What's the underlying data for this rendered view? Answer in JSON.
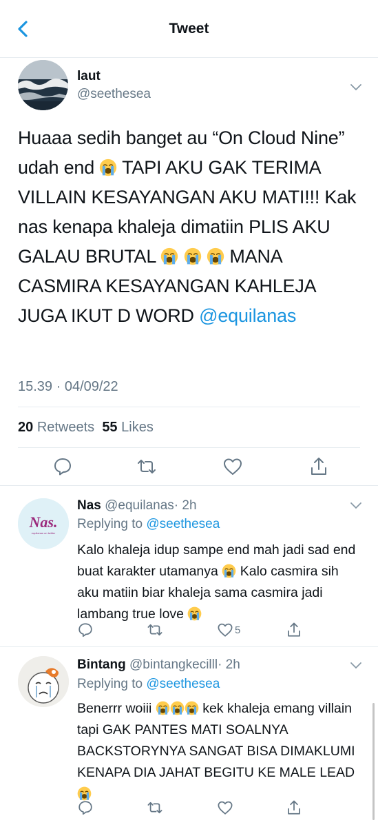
{
  "header": {
    "title": "Tweet",
    "back_icon": "chevron-left-icon",
    "accent_color": "#1b95e0"
  },
  "main_tweet": {
    "name": "laut",
    "handle": "@seethesea",
    "text_parts": {
      "p1": "Huaaa sedih banget au “On Cloud Nine” udah end ",
      "p2": " TAPI AKU GAK TERIMA VILLAIN KESAYANGAN AKU MATI!!! Kak nas kenapa khaleja dimatiin PLIS AKU GALAU BRUTAL ",
      "p3": " MANA CASMIRA KESAYANGAN KAHLEJA JUGA IKUT D WORD ",
      "mention": "@equilanas"
    },
    "timestamp": "15.39 · 04/09/22",
    "retweets_count": "20",
    "retweets_label": "Retweets",
    "likes_count": "55",
    "likes_label": "Likes"
  },
  "replies": [
    {
      "name": "Nas",
      "handle": "@equilanas",
      "time": "· 2h",
      "replying_prefix": "Replying to",
      "replying_to": "@seethesea",
      "text_parts": {
        "p1": "Kalo khaleja idup sampe end mah jadi sad end buat karakter utamanya ",
        "p2": " Kalo casmira sih aku matiin biar khaleja sama casmira jadi lambang true love "
      },
      "avatar_logo": "Nas.",
      "avatar_caption": "equilanas on twitter",
      "like_count": "5"
    },
    {
      "name": "Bintang",
      "handle": "@bintangkecilll",
      "time": "· 2h",
      "replying_prefix": "Replying to",
      "replying_to": "@seethesea",
      "text_parts": {
        "p1": "Benerrr woiii ",
        "p2": " kek khaleja emang villain tapi GAK PANTES MATI SOALNYA BACKSTORYNYA SANGAT BISA DIMAKLUMI KENAPA DIA JAHAT BEGITU KE MALE LEAD "
      }
    }
  ]
}
